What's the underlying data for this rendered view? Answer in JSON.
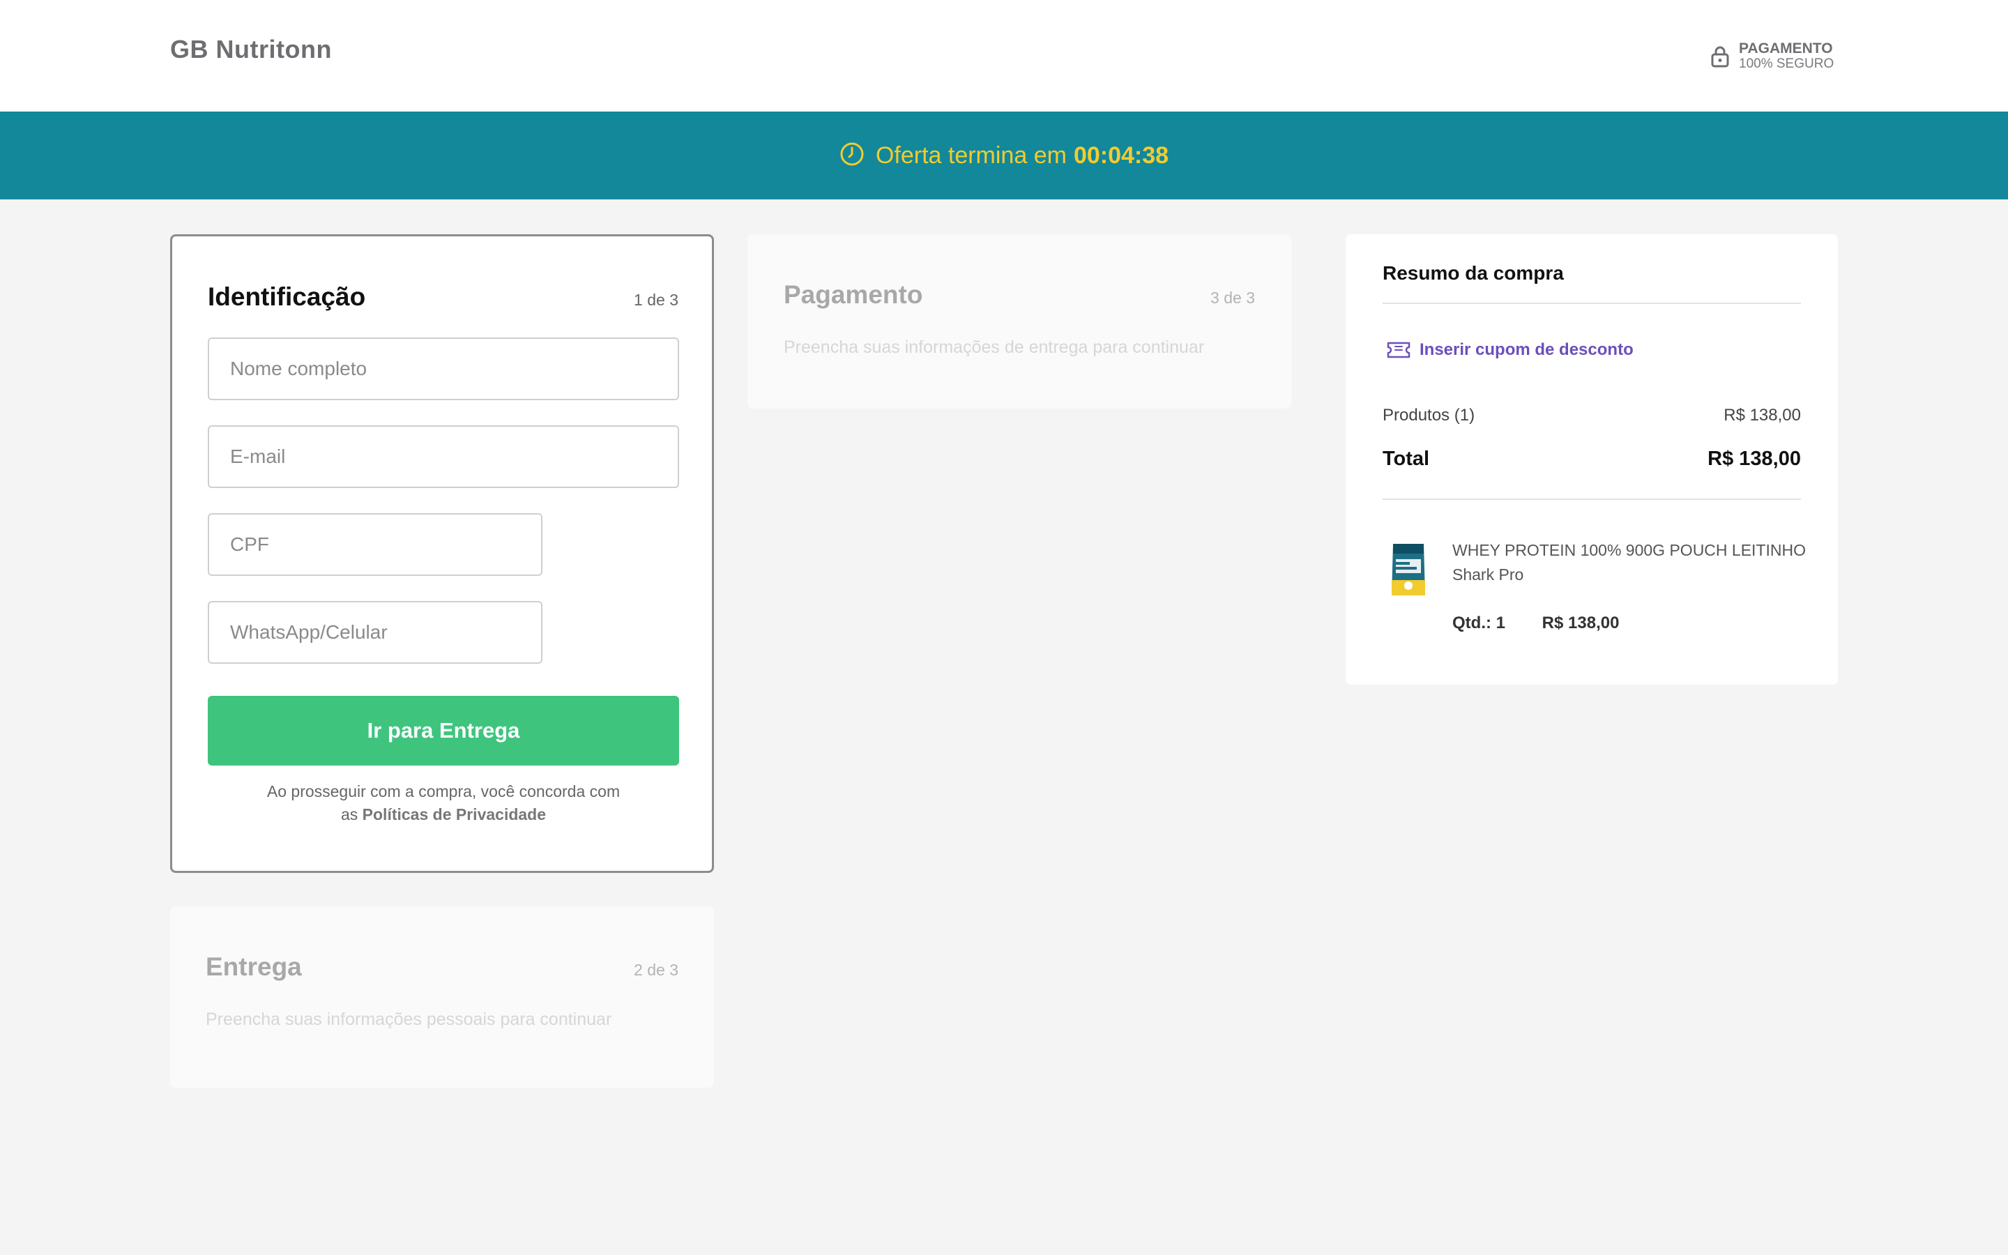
{
  "header": {
    "brand": "GB Nutritonn",
    "secure_line1": "PAGAMENTO",
    "secure_line2": "100% SEGURO"
  },
  "banner": {
    "text": "Oferta termina em",
    "timer": "00:04:38"
  },
  "identificacao": {
    "title": "Identificação",
    "step": "1 de 3",
    "fields": {
      "name_placeholder": "Nome completo",
      "email_placeholder": "E-mail",
      "cpf_placeholder": "CPF",
      "phone_placeholder": "WhatsApp/Celular"
    },
    "button_label": "Ir para Entrega",
    "terms_text_1": "Ao prosseguir com a compra, você concorda com",
    "terms_text_2": "as",
    "terms_link": "Políticas de Privacidade"
  },
  "entrega": {
    "title": "Entrega",
    "step": "2 de 3",
    "description": "Preencha suas informações pessoais para continuar"
  },
  "pagamento": {
    "title": "Pagamento",
    "step": "3 de 3",
    "description": "Preencha suas informações de entrega para continuar"
  },
  "summary": {
    "title": "Resumo da compra",
    "coupon_label": "Inserir cupom de desconto",
    "products_label": "Produtos (1)",
    "products_value": "R$ 138,00",
    "total_label": "Total",
    "total_value": "R$ 138,00",
    "item": {
      "name": "WHEY PROTEIN 100% 900G POUCH LEITINHO",
      "brand": "Shark Pro",
      "quantity": "Qtd.: 1",
      "price": "R$ 138,00"
    }
  },
  "colors": {
    "banner_bg": "#12889a",
    "banner_text": "#f2cb2f",
    "button_bg": "#3fc47e",
    "coupon": "#6b4fbb"
  }
}
